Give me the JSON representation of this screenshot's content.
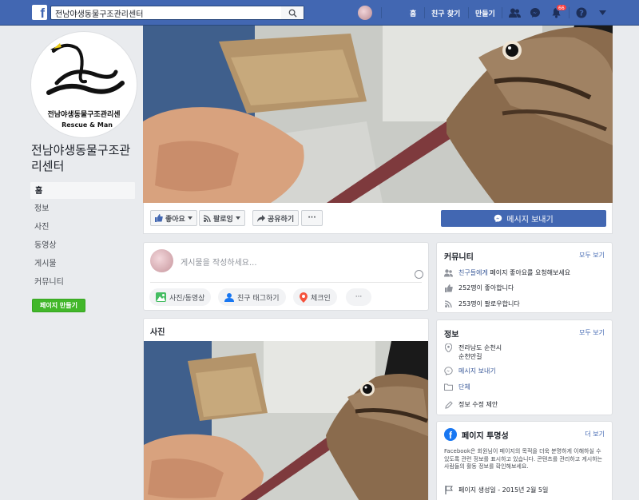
{
  "topbar": {
    "search_value": "전남야생동물구조관리센터",
    "nav": {
      "home": "홈",
      "find_friends": "친구 찾기",
      "create": "만들기"
    },
    "notification_count": "66"
  },
  "page": {
    "name": "전남야생동물구조관리센터",
    "logo_text_line1": "전남야생동물구조관리센",
    "logo_text_line2": "Rescue & Man"
  },
  "sidebar": {
    "items": [
      {
        "label": "홈"
      },
      {
        "label": "정보"
      },
      {
        "label": "사진"
      },
      {
        "label": "동영상"
      },
      {
        "label": "게시물"
      },
      {
        "label": "커뮤니티"
      }
    ],
    "create_page": "페이지 만들기"
  },
  "actions": {
    "like": "좋아요",
    "follow": "팔로잉",
    "share": "공유하기",
    "more": "···",
    "message": "메시지 보내기"
  },
  "composer": {
    "placeholder": "게시물을 작성하세요...",
    "photo_video": "사진/동영상",
    "tag_friends": "친구 태그하기",
    "check_in": "체크인",
    "more": "···"
  },
  "photos": {
    "title": "사진"
  },
  "community": {
    "title": "커뮤니티",
    "see_all": "모두 보기",
    "invite_link": "친구들에게",
    "invite_rest": "페이지 좋아요를 요청해보세요",
    "likes": "252명이 좋아합니다",
    "follows": "253명이 팔로우합니다"
  },
  "info": {
    "title": "정보",
    "see_all": "모두 보기",
    "address_line1": "전라남도 순천시",
    "address_line2": "순천만길",
    "message": "메시지 보내기",
    "category": "단체",
    "suggest_edit": "정보 수정 제안"
  },
  "transparency": {
    "title": "페이지 투명성",
    "see_more": "더 보기",
    "text": "Facebook은 회원님이 페이지의 목적을 더욱 분명하게 이해하실 수 있도록 관련 정보를 표시하고 있습니다. 콘텐츠를 관리하고 게시하는 사람들의 활동 정보를 확인해보세요.",
    "created": "페이지 생성일 - 2015년 2월 5일"
  },
  "colors": {
    "brand": "#4267b2",
    "background": "#e9ebee",
    "create_button": "#42b72a",
    "badge": "#fa3e3e",
    "link": "#385898"
  }
}
